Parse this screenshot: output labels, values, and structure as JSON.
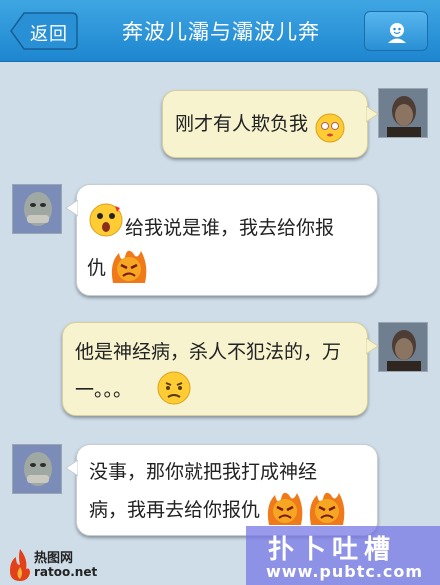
{
  "header": {
    "back_label": "返回",
    "title": "奔波儿灞与灞波儿奔",
    "profile_icon": "person-icon"
  },
  "messages": [
    {
      "side": "right",
      "lines": [
        "刚才有人欺负我"
      ],
      "emoji": [
        "shy-face-emoji"
      ]
    },
    {
      "side": "left",
      "lines": [
        "给我说是谁，我去给你报",
        "仇"
      ],
      "emoji": [
        "shocked-face-emoji",
        "angry-fire-emoji"
      ]
    },
    {
      "side": "right",
      "lines": [
        "他是神经病，杀人不犯法的，万",
        "一。。。"
      ],
      "emoji": [
        "worried-face-emoji"
      ]
    },
    {
      "side": "left",
      "lines": [
        "没事，那你就把我打成神经",
        "病，我再去给你报仇"
      ],
      "emoji": [
        "angry-fire-emoji",
        "angry-fire-emoji"
      ]
    }
  ],
  "watermarks": {
    "left_name": "热图网",
    "left_url": "ratoo.net",
    "right_big": "扑卜吐槽",
    "right_site": "www.pubtc.com"
  },
  "colors": {
    "header_blue": "#1d86cf",
    "chat_bg": "#cfdde9",
    "bubble_yellow": "#f7f3cf",
    "bubble_white": "#ffffff"
  }
}
